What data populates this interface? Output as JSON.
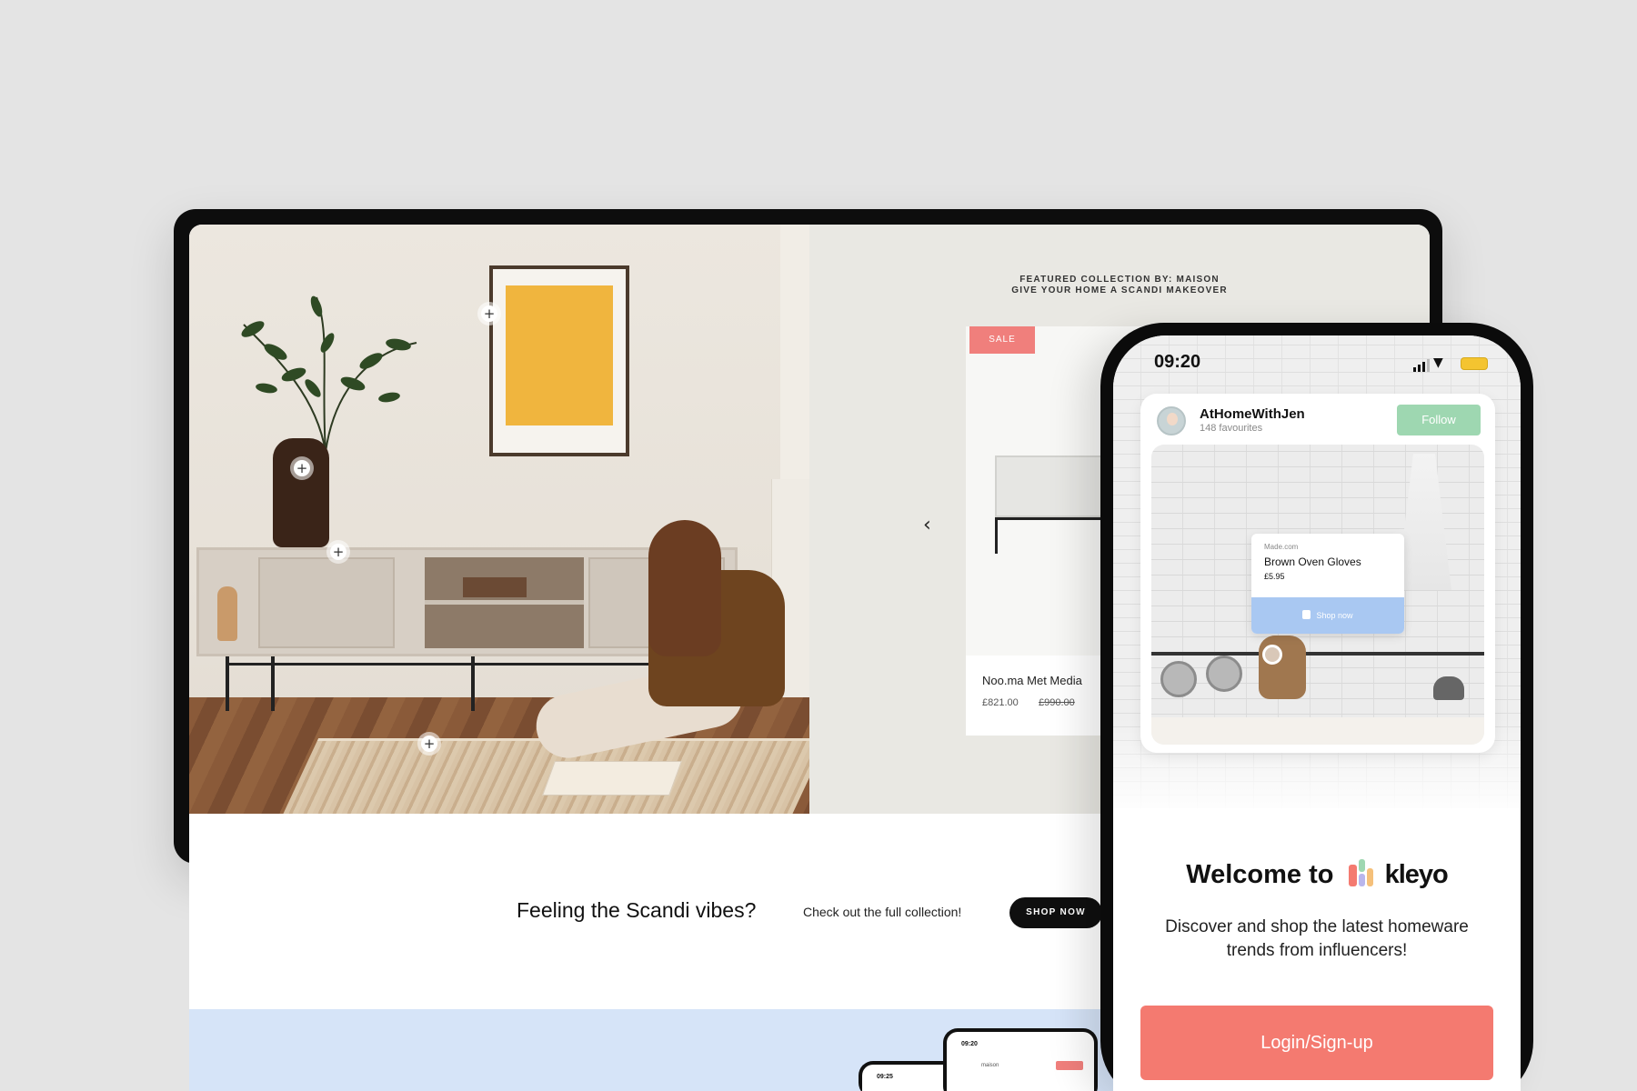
{
  "desktop": {
    "collection": {
      "eyebrow_line1": "FEATURED COLLECTION BY: MAISON",
      "eyebrow_line2": "GIVE YOUR HOME A SCANDI MAKEOVER",
      "prev_icon": "chevron-left-icon",
      "sale_label": "SALE",
      "product_name": "Noo.ma Met Media",
      "product_price": "£821.00",
      "product_old_price": "£990.00"
    },
    "cta": {
      "title": "Feeling the Scandi vibes?",
      "subtitle": "Check out the full collection!",
      "button": "SHOP NOW"
    },
    "mini_phones": [
      {
        "time": "09:25",
        "user": "",
        "badge": ""
      },
      {
        "time": "09:20",
        "user": "maison",
        "badge": ""
      }
    ]
  },
  "phone": {
    "time": "09:20",
    "post": {
      "username": "AtHomeWithJen",
      "favourites": "148 favourites",
      "follow_label": "Follow",
      "tooltip": {
        "source": "Made.com",
        "product": "Brown Oven Gloves",
        "price": "£5.95",
        "shop_label": "Shop now"
      }
    },
    "welcome_prefix": "Welcome to",
    "brand": "kleyo",
    "description": "Discover and shop the latest homeware trends from influencers!",
    "login_label": "Login/Sign-up"
  },
  "colors": {
    "accent_coral": "#f47a70",
    "follow_green": "#9ed7b1",
    "shop_blue": "#a9c8f2",
    "sale_red": "#f07f7c",
    "band_blue": "#d6e4f8"
  }
}
